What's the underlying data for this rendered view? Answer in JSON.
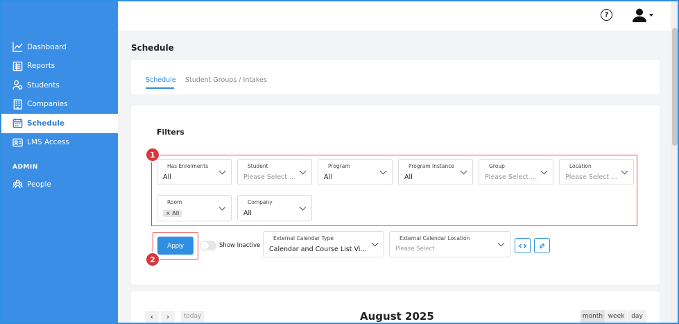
{
  "sidebar": {
    "items": [
      {
        "label": "Dashboard",
        "icon": "chart-line-icon",
        "active": false
      },
      {
        "label": "Reports",
        "icon": "report-icon",
        "active": false
      },
      {
        "label": "Students",
        "icon": "students-icon",
        "active": false
      },
      {
        "label": "Companies",
        "icon": "building-icon",
        "active": false
      },
      {
        "label": "Schedule",
        "icon": "calendar-icon",
        "active": true
      },
      {
        "label": "LMS Access",
        "icon": "id-card-icon",
        "active": false
      }
    ],
    "section_label": "ADMIN",
    "admin_items": [
      {
        "label": "People",
        "icon": "people-icon"
      }
    ]
  },
  "header": {
    "help_symbol": "?"
  },
  "page": {
    "title": "Schedule",
    "tabs": [
      {
        "label": "Schedule",
        "active": true
      },
      {
        "label": "Student Groups / Intakes",
        "active": false
      }
    ]
  },
  "filters": {
    "title": "Filters",
    "badges": [
      "1",
      "2"
    ],
    "row1": [
      {
        "label": "Has Enrolments",
        "value": "All",
        "placeholder": false
      },
      {
        "label": "Student",
        "value": "Please Select ...",
        "placeholder": true
      },
      {
        "label": "Program",
        "value": "All",
        "placeholder": false
      },
      {
        "label": "Program Instance",
        "value": "All",
        "placeholder": false
      },
      {
        "label": "Group",
        "value": "Please Select ...",
        "placeholder": true
      },
      {
        "label": "Location",
        "value": "Please Select l...",
        "placeholder": true
      }
    ],
    "room": {
      "label": "Room",
      "tag": "All",
      "tag_remove": "×"
    },
    "company": {
      "label": "Company",
      "value": "All"
    },
    "apply_label": "Apply",
    "show_inactive_label": "Show Inactive",
    "ext_type": {
      "label": "External Calendar Type",
      "value": "Calendar and Course List View"
    },
    "ext_location": {
      "label": "External Calendar Location",
      "value": "Please Select"
    }
  },
  "calendar": {
    "title": "August 2025",
    "prev": "‹",
    "next": "›",
    "today_label": "today",
    "views": [
      "month",
      "week",
      "day"
    ],
    "active_view": "month"
  },
  "colors": {
    "sidebar": "#3a8ee6",
    "accent": "#2f8fe0",
    "annotation_red": "#d9363e"
  }
}
